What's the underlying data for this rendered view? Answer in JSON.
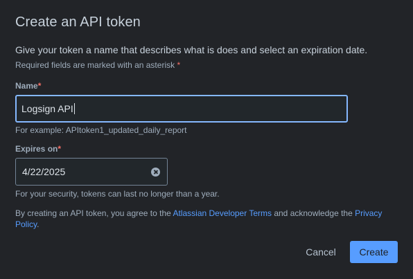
{
  "dialog": {
    "title": "Create an API token",
    "description": "Give your token a name that describes what is does and select an expiration date.",
    "required_note": "Required fields are marked with an asterisk",
    "asterisk": "*"
  },
  "name_field": {
    "label": "Name",
    "value": "Logsign API",
    "helper": "For example: APItoken1_updated_daily_report"
  },
  "expires_field": {
    "label": "Expires on",
    "value": "4/22/2025",
    "helper": "For your security, tokens can last no longer than a year.",
    "clear_icon": "clear-circle-x-icon"
  },
  "terms": {
    "prefix": "By creating an API token, you agree to the ",
    "link1": "Atlassian Developer Terms",
    "middle": " and acknowledge the ",
    "link2": "Privacy Policy",
    "suffix": "."
  },
  "actions": {
    "cancel_label": "Cancel",
    "create_label": "Create"
  },
  "colors": {
    "background": "#222428",
    "accent": "#579dff",
    "focus_border": "#85b8ff",
    "required": "#f87168"
  }
}
